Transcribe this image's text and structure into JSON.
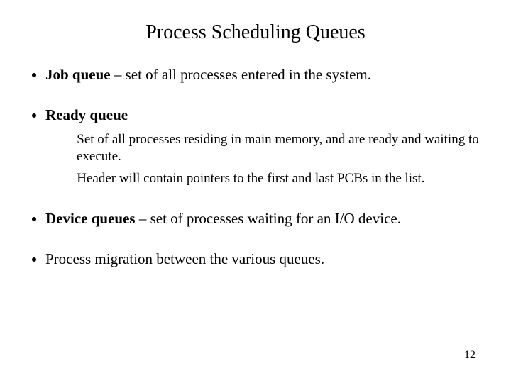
{
  "title": "Process Scheduling Queues",
  "bullets": {
    "b1": {
      "bold": "Job queue",
      "rest": " – set of all processes entered in the system."
    },
    "b2": {
      "bold": "Ready queue",
      "sub1": "Set of all processes residing in main memory, and are ready and waiting to execute.",
      "sub2": "Header will contain pointers to the first and last PCBs in the list."
    },
    "b3": {
      "bold": "Device queues",
      "rest": " – set of processes waiting for an I/O device."
    },
    "b4": {
      "text": "Process migration between the various queues."
    }
  },
  "page_number": "12"
}
